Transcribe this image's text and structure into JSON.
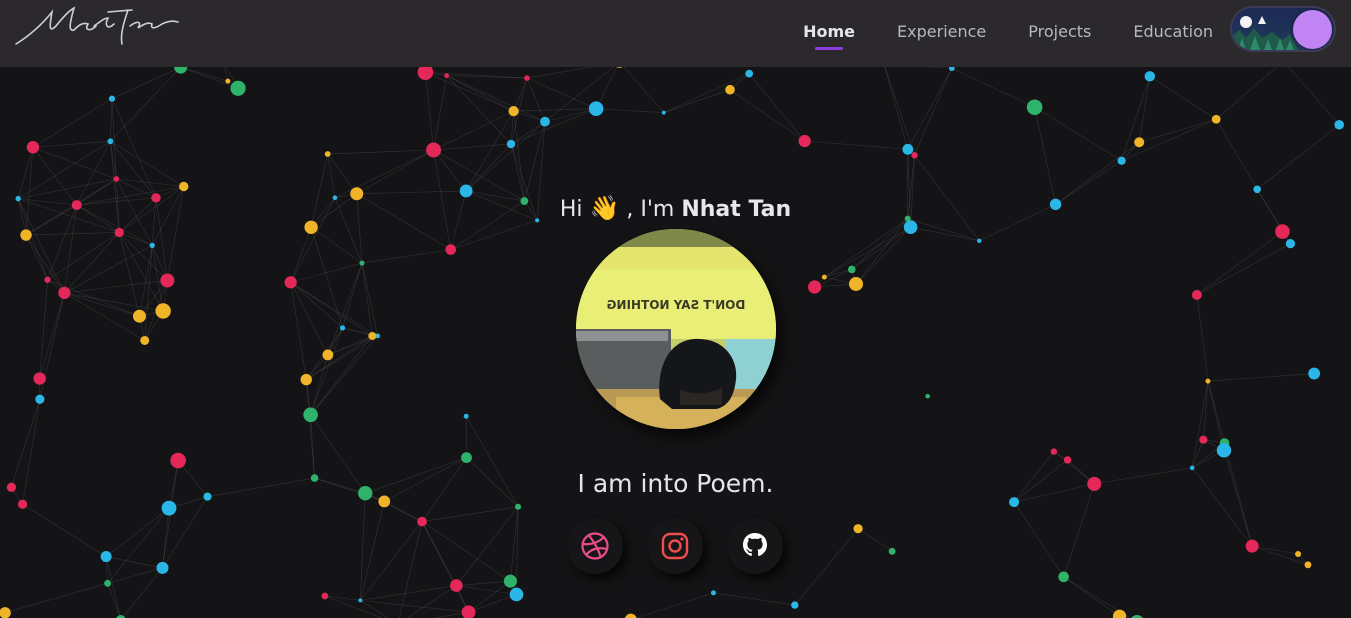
{
  "brand": {
    "logo_text": "Nhat Tan"
  },
  "nav": {
    "items": [
      {
        "label": "Home",
        "active": true
      },
      {
        "label": "Experience",
        "active": false
      },
      {
        "label": "Projects",
        "active": false
      },
      {
        "label": "Education",
        "active": false
      }
    ]
  },
  "theme_toggle": {
    "mode": "dark"
  },
  "hero": {
    "greeting_prefix": "Hi",
    "wave_emoji": "👋",
    "greeting_middle": ", I'm",
    "name": "Nhat Tan",
    "photo_sign_text": "DON'T SAY NOTHING",
    "tagline": "I am into Poem."
  },
  "socials": [
    {
      "name": "dribbble",
      "icon": "dribbble-icon",
      "color": "#ea4c89"
    },
    {
      "name": "instagram",
      "icon": "instagram-icon",
      "color": "#f04e4e"
    },
    {
      "name": "github",
      "icon": "github-icon",
      "color": "#ffffff"
    }
  ],
  "colors": {
    "background": "#141416",
    "navbar": "#2b292b",
    "accent": "#8b3fe0",
    "particles": [
      "#f0b429",
      "#2ab7e8",
      "#e4285a",
      "#2fb36b"
    ]
  }
}
